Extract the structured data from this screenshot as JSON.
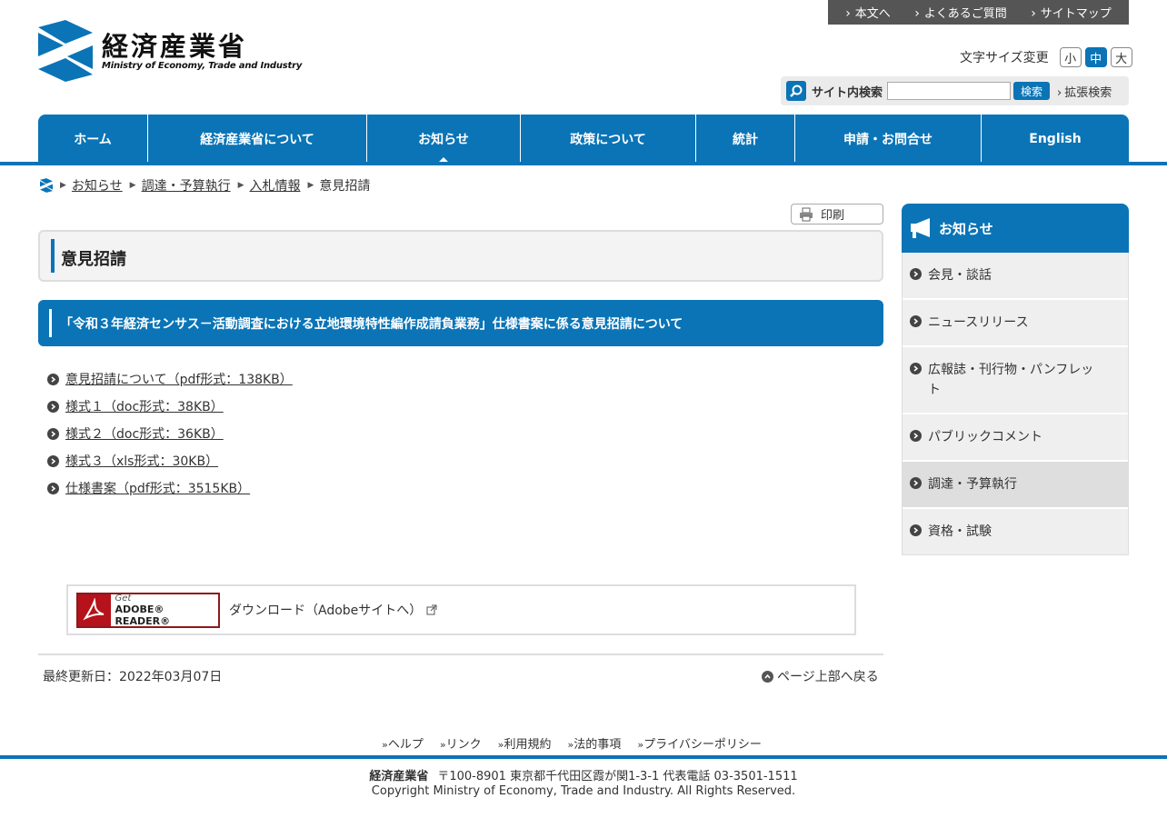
{
  "util_links": [
    "本文へ",
    "よくあるご質問",
    "サイトマップ"
  ],
  "logo": {
    "ja": "経済産業省",
    "en": "Ministry of Economy, Trade and Industry"
  },
  "font_size": {
    "label": "文字サイズ変更",
    "options": [
      "小",
      "中",
      "大"
    ],
    "selected": "中"
  },
  "search": {
    "label": "サイト内検索",
    "button": "検索",
    "advanced": "拡張検索",
    "value": ""
  },
  "gnav": [
    {
      "label": "ホーム",
      "width": 121
    },
    {
      "label": "経済産業省について",
      "width": 241
    },
    {
      "label": "お知らせ",
      "width": 169,
      "current": true
    },
    {
      "label": "政策について",
      "width": 193
    },
    {
      "label": "統計",
      "width": 109
    },
    {
      "label": "申請・お問合せ",
      "width": 205
    },
    {
      "label": "English",
      "width": 162
    }
  ],
  "breadcrumb": [
    "お知らせ",
    "調達・予算執行",
    "入札情報",
    "意見招請"
  ],
  "print_label": "印刷",
  "page_title": "意見招請",
  "section_heading": "「令和３年経済センサス－活動調査における立地環境特性編作成請負業務」仕様書案に係る意見招請について",
  "files": [
    "意見招請について（pdf形式：138KB）",
    "様式１（doc形式：38KB）",
    "様式２（doc形式：36KB）",
    "様式３（xls形式：30KB）",
    "仕様書案（pdf形式：3515KB）"
  ],
  "adobe": {
    "get": "Get",
    "reader": "ADOBE® READER®",
    "download": "ダウンロード（Adobeサイトへ）"
  },
  "last_updated": "最終更新日：2022年03月07日",
  "page_top": "ページ上部へ戻る",
  "side": {
    "title": "お知らせ",
    "items": [
      "会見・談話",
      "ニュースリリース",
      "広報誌・刊行物・パンフレット",
      "パブリックコメント",
      "調達・予算執行",
      "資格・試験"
    ],
    "active": "調達・予算執行"
  },
  "footer": {
    "links": [
      "ヘルプ",
      "リンク",
      "利用規約",
      "法的事項",
      "プライバシーポリシー"
    ],
    "org": "経済産業省",
    "address": "〒100-8901 東京都千代田区霞が関1-3-1 代表電話 03-3501-1511",
    "copyright": "Copyright Ministry of Economy, Trade and Industry. All Rights Reserved."
  },
  "colors": {
    "brand": "#0a74b6",
    "util_bar": "#555555"
  }
}
